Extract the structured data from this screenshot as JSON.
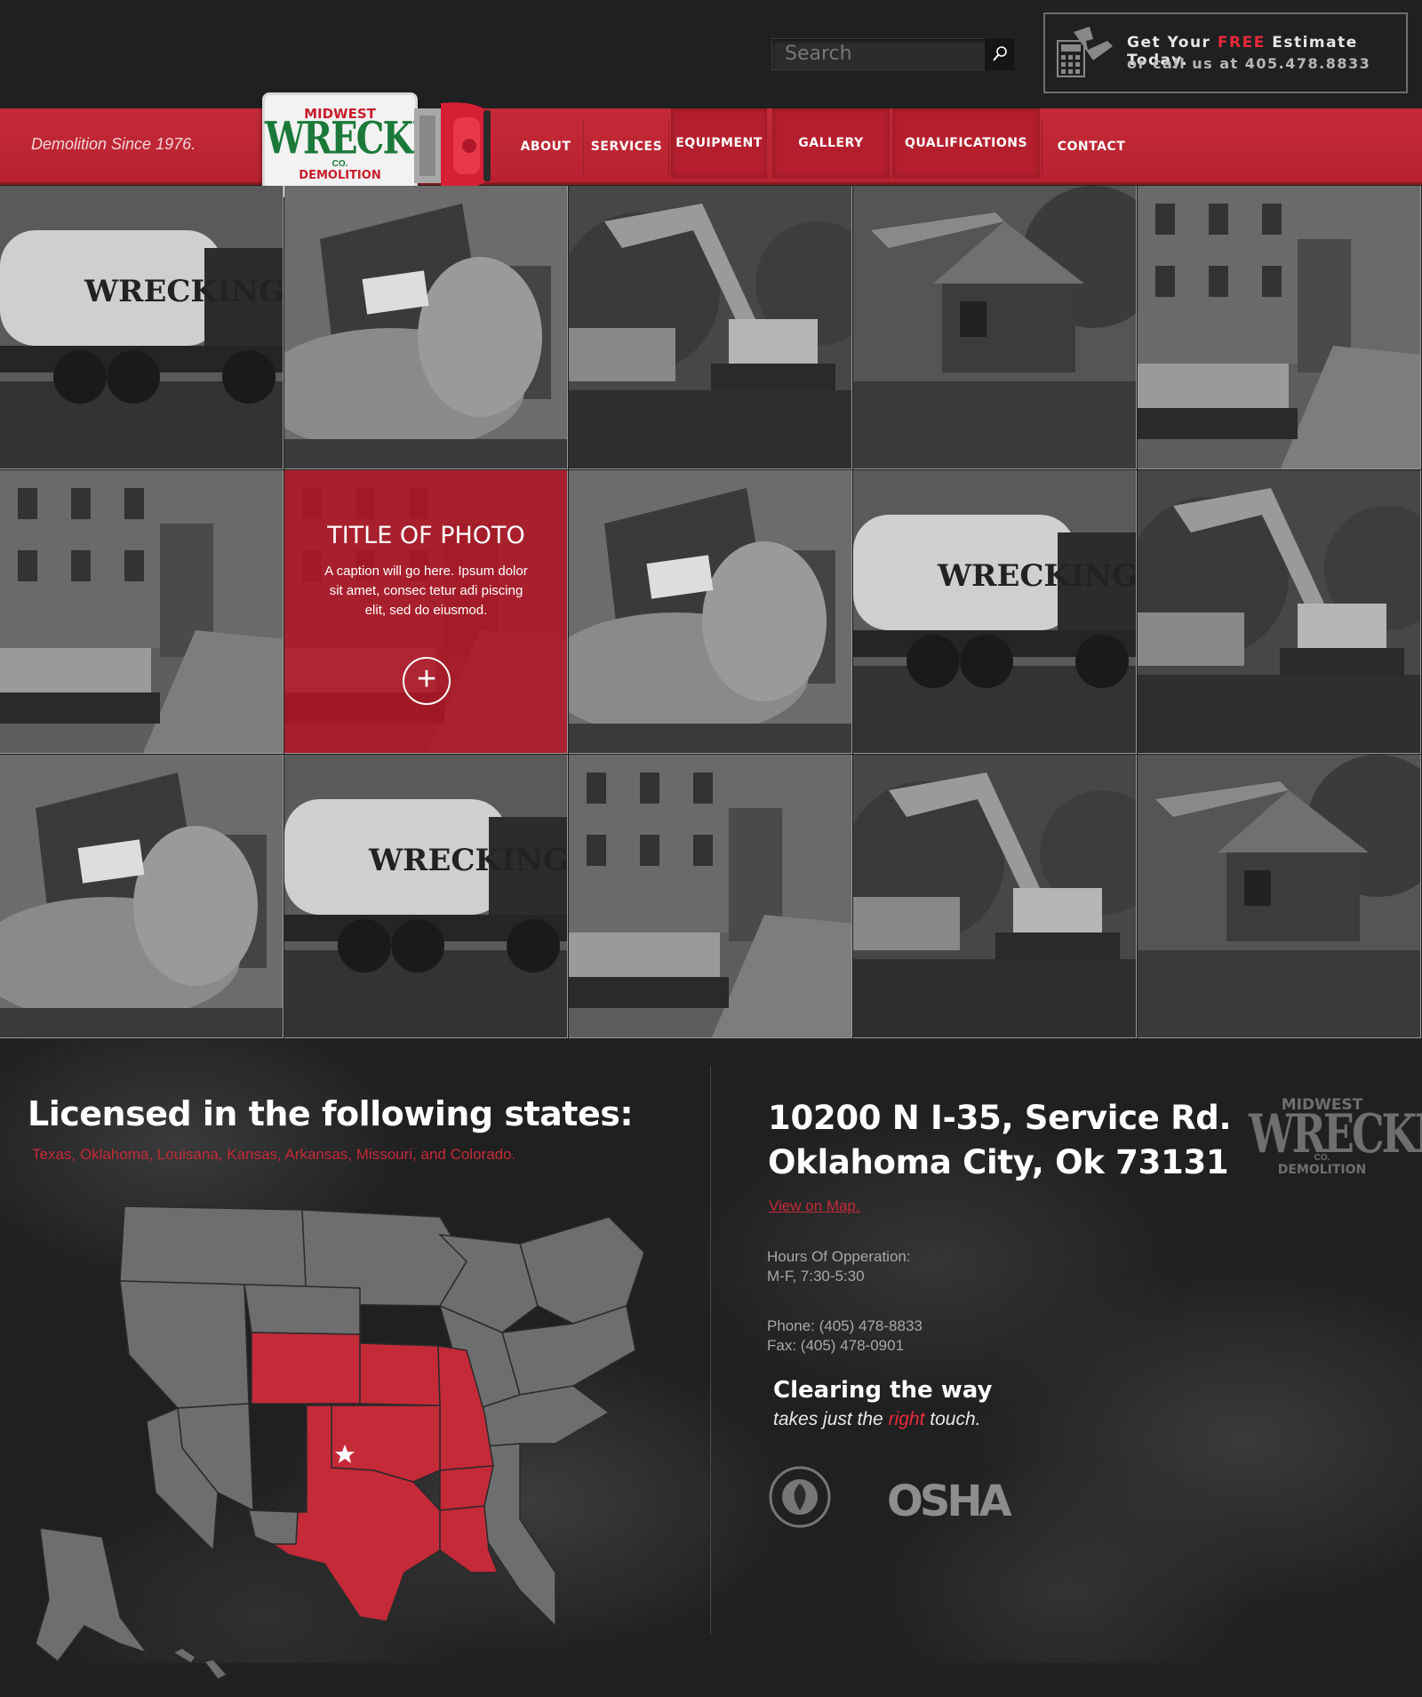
{
  "header": {
    "search_placeholder": "Search",
    "estimate_prefix": "Get Your ",
    "estimate_free": "FREE",
    "estimate_suffix": " Estimate Today.",
    "estimate_call": "or call us at 405.478.8833"
  },
  "nav": {
    "tagline": "Demolition Since 1976.",
    "items": [
      "ABOUT",
      "SERVICES",
      "EQUIPMENT",
      "GALLERY",
      "QUALIFICATIONS",
      "CONTACT"
    ]
  },
  "logo": {
    "top": "MIDWEST",
    "main": "WRECKING",
    "co": "CO.",
    "bottom": "DEMOLITION"
  },
  "gallery": {
    "overlay_title": "TITLE OF PHOTO",
    "overlay_caption": "A caption will go here. Ipsum dolor sit amet, consec tetur adi piscing elit, sed do eiusmod.",
    "photos": [
      "water-truck",
      "building-implosion",
      "excavator",
      "house-demolition",
      "loader-rubble",
      "loader-rubble",
      "highlighted",
      "building-implosion",
      "water-truck",
      "excavator",
      "building-implosion",
      "water-truck",
      "loader-rubble",
      "excavator",
      "house-demolition"
    ]
  },
  "footer": {
    "licensed_heading": "Licensed in the following states:",
    "licensed_states": "Texas, Oklahoma, Louisana, Kansas, Arkansas, Missouri, and Colorado.",
    "address_line1": "10200 N I-35, Service Rd.",
    "address_line2": "Oklahoma City, Ok 73131",
    "view_map": "View on Map.",
    "hours_label": "Hours Of Opperation:",
    "hours_value": "M-F, 7:30-5:30",
    "phone": "Phone: (405) 478-8833",
    "fax": "Fax: (405) 478-0901",
    "slogan_main": "Clearing the way",
    "slogan_pre": "takes just the ",
    "slogan_right": "right",
    "slogan_post": " touch.",
    "osha": "OSHA",
    "usgbc": "US GREEN BUILDING COUNCIL USGBC",
    "logo_top": "MIDWEST",
    "logo_main": "WRECKING",
    "logo_co": "CO.",
    "logo_bottom": "DEMOLITION"
  },
  "colors": {
    "accent_red": "#c42a38",
    "background": "#1f2021"
  }
}
